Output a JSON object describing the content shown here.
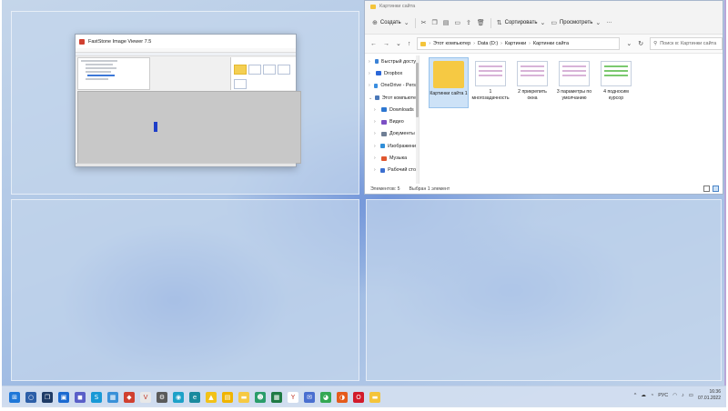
{
  "fastStone": {
    "title": "FastStone Image Viewer 7.5"
  },
  "explorer": {
    "window_title": "Картинки сайта",
    "toolbar": {
      "create_label": "Создать",
      "sort_label": "Сортировать",
      "view_label": "Просмотреть",
      "more_label": "···"
    },
    "breadcrumbs": [
      "Этот компьютер",
      "Data (D:)",
      "Картинки",
      "Картинки сайта"
    ],
    "search_placeholder": "Поиск в: Картинки сайта",
    "nav": [
      {
        "label": "Быстрый доступ",
        "color": "#3b82d6",
        "child": false
      },
      {
        "label": "Dropbox",
        "color": "#2b67d8",
        "child": false
      },
      {
        "label": "OneDrive - Perso",
        "color": "#3a8ee0",
        "child": false
      },
      {
        "label": "Этот компьютер",
        "color": "#4a78b8",
        "child": false
      },
      {
        "label": "Downloads",
        "color": "#2d77d1",
        "child": true
      },
      {
        "label": "Видео",
        "color": "#7b4fc4",
        "child": true
      },
      {
        "label": "Документы",
        "color": "#6f7f95",
        "child": true
      },
      {
        "label": "Изображения",
        "color": "#2f8ed9",
        "child": true
      },
      {
        "label": "Музыка",
        "color": "#e0572f",
        "child": true
      },
      {
        "label": "Рабочий стол",
        "color": "#3c6fd0",
        "child": true
      }
    ],
    "files": [
      {
        "name": "Картинки сайта 1",
        "type": "folder",
        "selected": true
      },
      {
        "name": "1 многозадачность",
        "type": "image",
        "selected": false
      },
      {
        "name": "2 прикрепить окна",
        "type": "image",
        "selected": false
      },
      {
        "name": "3 параметры по умолчанию",
        "type": "image",
        "selected": false
      },
      {
        "name": "4 подносим курсор",
        "type": "image-green",
        "selected": false
      }
    ],
    "status": {
      "items": "Элементов: 5",
      "selected": "Выбран 1 элемент"
    }
  },
  "taskbar": {
    "apps": [
      {
        "icon": "windows-start-icon",
        "color": "#1e77d8",
        "glyph": "⊞"
      },
      {
        "icon": "search-icon",
        "color": "#2d5fa8",
        "glyph": "○"
      },
      {
        "icon": "task-view-icon",
        "color": "#1f3b66",
        "glyph": "❐"
      },
      {
        "icon": "widgets-icon",
        "color": "#1b6ad1",
        "glyph": "▣"
      },
      {
        "icon": "chat-icon",
        "color": "#5a5fc8",
        "glyph": "◼"
      },
      {
        "icon": "skype-icon",
        "color": "#1899d6",
        "glyph": "S"
      },
      {
        "icon": "photos-icon",
        "color": "#3a91d8",
        "glyph": "▦"
      },
      {
        "icon": "faststone-icon",
        "color": "#d04030",
        "glyph": "◆"
      },
      {
        "icon": "antivirus-icon",
        "color": "#e8e8e8",
        "glyph": "V"
      },
      {
        "icon": "settings-icon",
        "color": "#5a5a5a",
        "glyph": "⚙"
      },
      {
        "icon": "app-icon",
        "color": "#1da1c8",
        "glyph": "◉"
      },
      {
        "icon": "edge-icon",
        "color": "#1a8a9e",
        "glyph": "e"
      },
      {
        "icon": "warning-app-icon",
        "color": "#f2c218",
        "glyph": "▲"
      },
      {
        "icon": "notes-icon",
        "color": "#f0b400",
        "glyph": "▤"
      },
      {
        "icon": "file-explorer-icon",
        "color": "#f6c943",
        "glyph": "▬"
      },
      {
        "icon": "people-icon",
        "color": "#2a9d6a",
        "glyph": "☻"
      },
      {
        "icon": "sheets-icon",
        "color": "#1f7a44",
        "glyph": "▦"
      },
      {
        "icon": "yandex-icon",
        "color": "#ffffff",
        "glyph": "Y"
      },
      {
        "icon": "mail-icon",
        "color": "#4a6fd0",
        "glyph": "✉"
      },
      {
        "icon": "chrome-icon",
        "color": "#34a853",
        "glyph": "◕"
      },
      {
        "icon": "firefox-icon",
        "color": "#e55b1b",
        "glyph": "◑"
      },
      {
        "icon": "opera-icon",
        "color": "#d21b2b",
        "glyph": "O"
      },
      {
        "icon": "explorer-icon",
        "color": "#f4c43a",
        "glyph": "▬"
      }
    ],
    "tray": {
      "chevron": "^",
      "lang": "РУС",
      "time": "16:36",
      "date": "07.01.2022"
    }
  }
}
